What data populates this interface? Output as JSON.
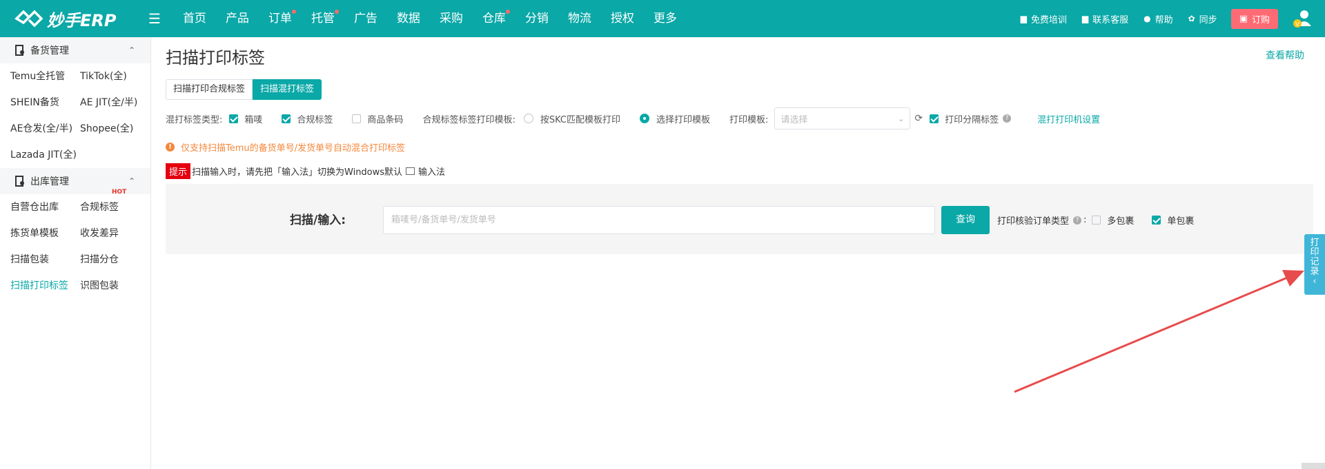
{
  "app": {
    "logo_text": "妙手ERP",
    "nav": [
      {
        "label": "首页",
        "dot": false
      },
      {
        "label": "产品",
        "dot": false
      },
      {
        "label": "订单",
        "dot": true
      },
      {
        "label": "托管",
        "dot": true
      },
      {
        "label": "广告",
        "dot": false
      },
      {
        "label": "数据",
        "dot": false
      },
      {
        "label": "采购",
        "dot": false
      },
      {
        "label": "仓库",
        "dot": true
      },
      {
        "label": "分销",
        "dot": false
      },
      {
        "label": "物流",
        "dot": false
      },
      {
        "label": "授权",
        "dot": false
      },
      {
        "label": "更多",
        "dot": false
      }
    ],
    "top_right": {
      "training": "免费培训",
      "support": "联系客服",
      "help": "帮助",
      "sync": "同步",
      "order": "订购"
    }
  },
  "sidebar": {
    "group1_title": "备货管理",
    "group1_items": [
      "Temu全托管",
      "TikTok(全)",
      "SHEIN备货",
      "AE JIT(全/半)",
      "AE仓发(全/半)",
      "Shopee(全)",
      "Lazada JIT(全)"
    ],
    "group2_title": "出库管理",
    "group2_items": [
      "自营仓出库",
      "合规标签",
      "拣货单模板",
      "收发差异",
      "扫描包装",
      "扫描分仓",
      "扫描打印标签",
      "识图包装"
    ],
    "hot_badge": "HOT"
  },
  "page": {
    "title": "扫描打印标签",
    "help_link": "查看帮助",
    "tabs": [
      "扫描打印合规标签",
      "扫描混打标签"
    ],
    "options": {
      "type_label": "混打标签类型:",
      "box_mark": "箱唛",
      "compliance_label": "合规标签",
      "barcode": "商品条码",
      "template_label": "合规标签标签打印模板:",
      "radio_skc": "按SKC匹配模板打印",
      "radio_select": "选择打印模板",
      "print_template_label": "打印模板:",
      "print_template_placeholder": "请选择",
      "print_separator": "打印分隔标签",
      "printer_settings": "混打打印机设置"
    },
    "notice": "仅支持扫描Temu的备货单号/发货单号自动混合打印标签",
    "tip_badge": "提示",
    "tip_text": "扫描输入时，请先把「输入法」切换为Windows默认",
    "tip_ime": "输入法",
    "scan": {
      "label": "扫描/输入:",
      "placeholder": "箱唛号/备货单号/发货单号",
      "query": "查询",
      "verify_label": "打印核验订单类型",
      "multi": "多包裹",
      "single": "单包裹"
    },
    "side_tab": [
      "打",
      "印",
      "记",
      "录",
      "‹"
    ]
  },
  "colors": {
    "brand": "#0aa8a7",
    "notice": "#f5873b",
    "tip_badge": "#e5000f",
    "order_button": "#ff6b75",
    "annotation_arrow": "#e84b4b"
  }
}
